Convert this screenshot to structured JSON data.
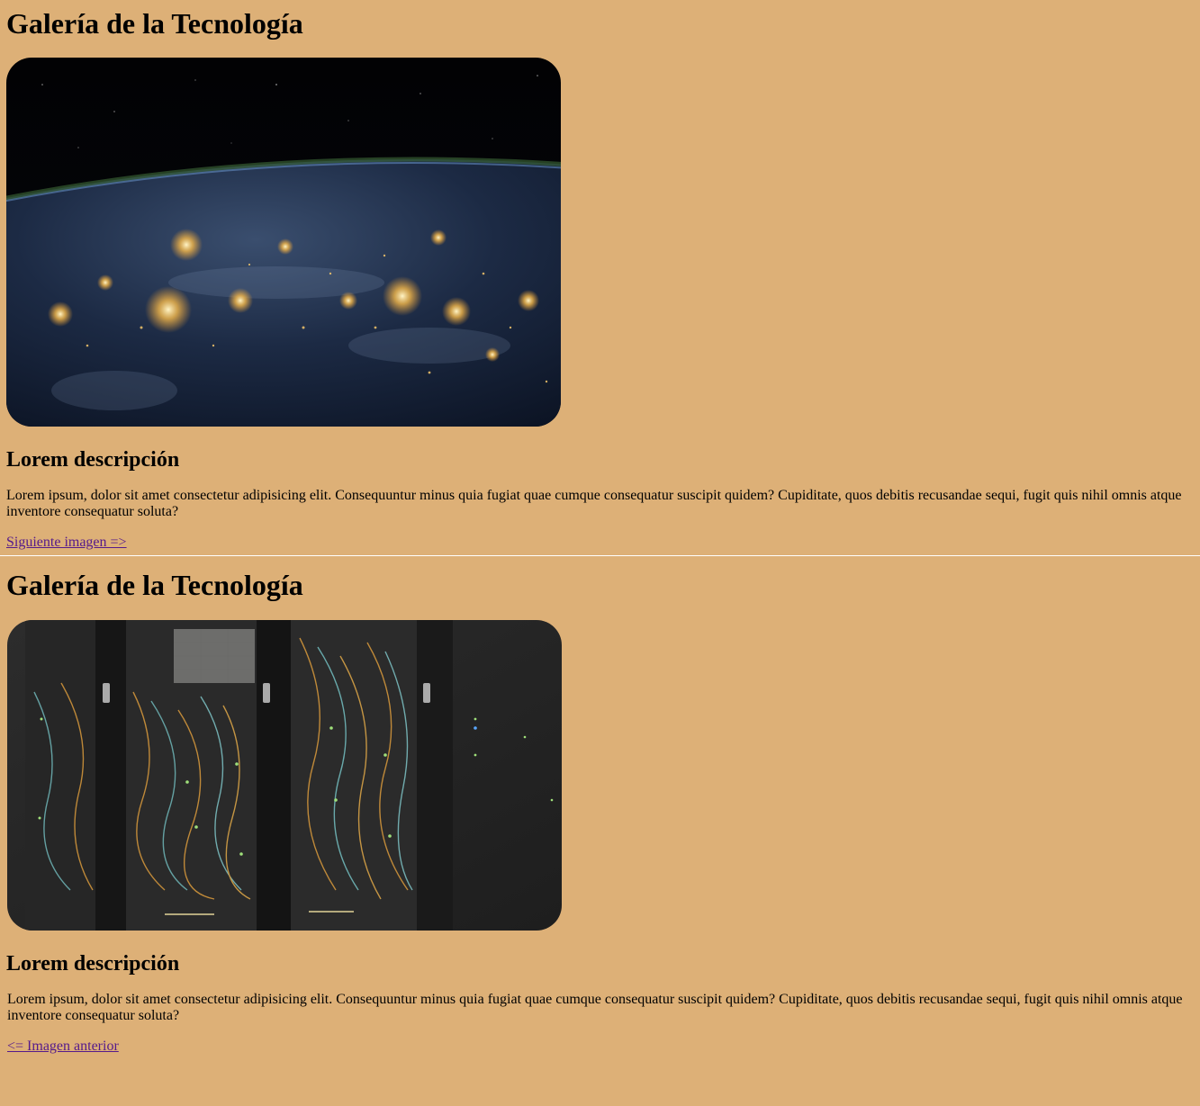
{
  "slides": [
    {
      "title": "Galería de la Tecnología",
      "image": "earth-at-night-from-space",
      "heading": "Lorem descripción",
      "description": "Lorem ipsum, dolor sit amet consectetur adipisicing elit. Consequuntur minus quia fugiat quae cumque consequatur suscipit quidem? Cupiditate, quos debitis recusandae sequi, fugit quis nihil omnis atque inventore consequatur soluta?",
      "link_label": "Siguiente imagen =>"
    },
    {
      "title": "Galería de la Tecnología",
      "image": "server-racks-with-cables",
      "heading": "Lorem descripción",
      "description": "Lorem ipsum, dolor sit amet consectetur adipisicing elit. Consequuntur minus quia fugiat quae cumque consequatur suscipit quidem? Cupiditate, quos debitis recusandae sequi, fugit quis nihil omnis atque inventore consequatur soluta?",
      "link_label": "<= Imagen anterior"
    }
  ],
  "colors": {
    "background": "#ddb077",
    "divider": "#ffffff",
    "link": "#551a8b"
  }
}
